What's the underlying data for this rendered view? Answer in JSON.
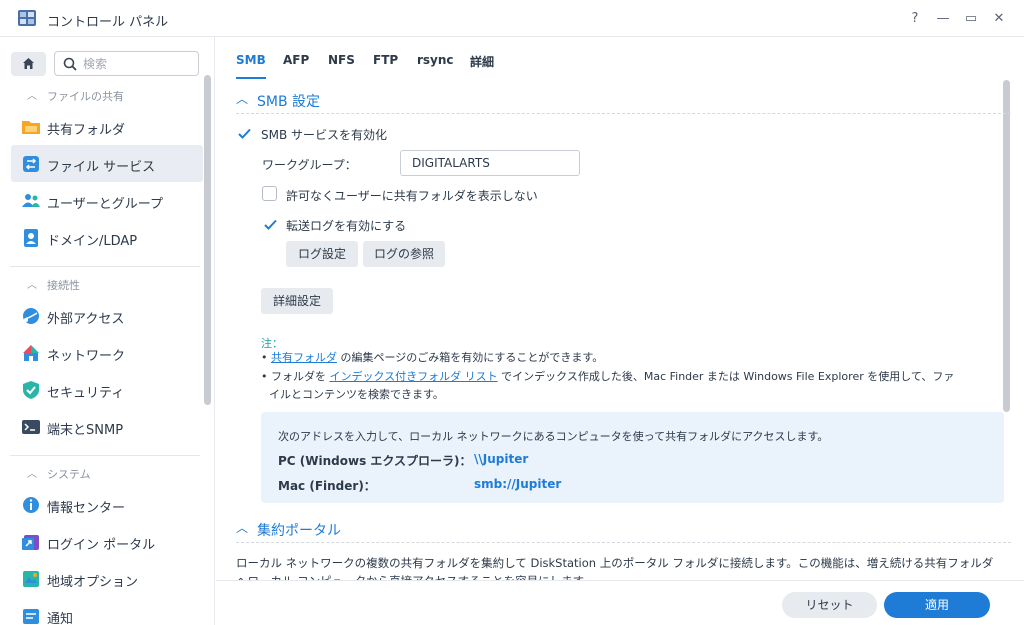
{
  "window": {
    "title": "コントロール パネル",
    "help": "?",
    "minimize": "—",
    "maximize": "▭",
    "close": "✕"
  },
  "sidebar": {
    "search_placeholder": "検索",
    "groups": [
      {
        "label": "ファイルの共有"
      },
      {
        "label": "接続性"
      },
      {
        "label": "システム"
      }
    ],
    "items": [
      {
        "label": "共有フォルダ",
        "icon": "shared-folder-icon"
      },
      {
        "label": "ファイル サービス",
        "icon": "file-services-icon",
        "active": true
      },
      {
        "label": "ユーザーとグループ",
        "icon": "users-groups-icon"
      },
      {
        "label": "ドメイン/LDAP",
        "icon": "domain-ldap-icon"
      },
      {
        "label": "外部アクセス",
        "icon": "external-access-icon"
      },
      {
        "label": "ネットワーク",
        "icon": "network-icon"
      },
      {
        "label": "セキュリティ",
        "icon": "security-shield-icon"
      },
      {
        "label": "端末とSNMP",
        "icon": "terminal-icon"
      },
      {
        "label": "情報センター",
        "icon": "info-center-icon"
      },
      {
        "label": "ログイン ポータル",
        "icon": "login-portal-icon"
      },
      {
        "label": "地域オプション",
        "icon": "regional-options-icon"
      },
      {
        "label": "通知",
        "icon": "notification-icon"
      }
    ]
  },
  "tabs": [
    "SMB",
    "AFP",
    "NFS",
    "FTP",
    "rsync",
    "詳細"
  ],
  "smb": {
    "section_title": "SMB 設定",
    "enable_label": "SMB サービスを有効化",
    "enable_checked": true,
    "workgroup_label": "ワークグループ：",
    "workgroup_value": "DIGITALARTS",
    "hide_label": "許可なくユーザーに共有フォルダを表示しない",
    "hide_checked": false,
    "log_label": "転送ログを有効にする",
    "log_checked": true,
    "log_settings_btn": "ログ設定",
    "log_view_btn": "ログの参照",
    "advanced_btn": "詳細設定",
    "note_title": "注：",
    "note1_link": "共有フォルダ",
    "note1_rest": " の編集ページのごみ箱を有効にすることができます。",
    "note2_pre": "フォルダを ",
    "note2_link": "インデックス付きフォルダ リスト",
    "note2_rest": " でインデックス作成した後、Mac Finder または Windows File Explorer を使用して、ファ",
    "note2_cont": "イルとコンテンツを検索できます。",
    "info_text": "次のアドレスを入力して、ローカル ネットワークにあるコンピュータを使って共有フォルダにアクセスします。",
    "pc_label": "PC (Windows エクスプローラ)：",
    "pc_value": "\\\\Jupiter",
    "mac_label": "Mac (Finder)：",
    "mac_value": "smb://Jupiter"
  },
  "portal": {
    "section_title": "集約ポータル",
    "desc1": "ローカル ネットワークの複数の共有フォルダを集約して DiskStation 上のポータル フォルダに接続します。この機能は、増え続ける共有フォルダ",
    "desc2": "へローカル コンピュータから直接アクセスすることを容易にします。"
  },
  "footer": {
    "reset": "リセット",
    "apply": "適用"
  },
  "colors": {
    "accent": "#1e7bd6",
    "active_bg": "#e9edf3"
  }
}
